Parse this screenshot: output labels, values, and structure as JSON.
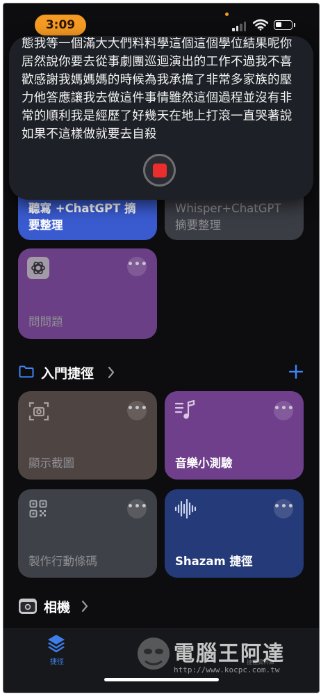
{
  "status_bar": {
    "time": "3:09"
  },
  "dictation": {
    "transcript": "態我等一個滿大大們料料學這個這個學位結果呢你居然說你要去從事劇團巡迴演出的工作不過我不喜歡感謝我媽媽媽的時候為我承擔了非常多家族的壓力他答應讓我去做這件事情雖然這個過程並沒有非常的順利我是經歷了好幾天在地上打滾一直哭著說如果不這樣做就要去自殺"
  },
  "shortcuts_top": [
    {
      "title": "聽寫 +ChatGPT 摘要整理",
      "color": "#3a5bd0"
    },
    {
      "title": "Whisper+ChatGPT 摘要整理",
      "color": "#3a3d44"
    },
    {
      "title": "問問題",
      "color": "#6b3f86",
      "icon": "chatgpt-icon"
    }
  ],
  "starter_section": {
    "title": "入門捷徑",
    "shortcuts": [
      {
        "title": "顯示截圖",
        "icon": "screenshot-icon",
        "color": "#4e4442"
      },
      {
        "title": "音樂小測驗",
        "icon": "music-note-icon",
        "color": "#6f3f8c"
      },
      {
        "title": "製作行動條碼",
        "icon": "qr-code-icon",
        "color": "#3e4147"
      },
      {
        "title": "Shazam 捷徑",
        "icon": "waveform-icon",
        "color": "#253a78"
      }
    ]
  },
  "camera_section": {
    "title": "相機"
  },
  "tab_bar": {
    "tab_label": "捷徑"
  },
  "watermark": {
    "main": "電腦王阿達",
    "url": "http://www.kocpc.com.tw",
    "sub": "捷徑資料庫"
  }
}
